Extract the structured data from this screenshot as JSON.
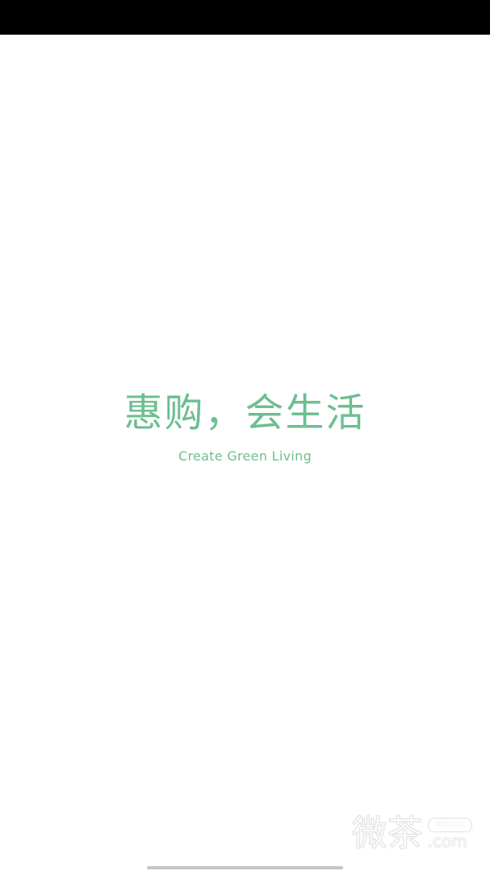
{
  "colors": {
    "brand": "#6cbf8f",
    "status_bar": "#000000",
    "background": "#ffffff"
  },
  "splash": {
    "slogan_cn": "惠购，会生活",
    "slogan_en": "Create Green Living"
  },
  "watermark": {
    "cn": "微茶",
    "badge": "WXCHA",
    "suffix": ".com"
  }
}
